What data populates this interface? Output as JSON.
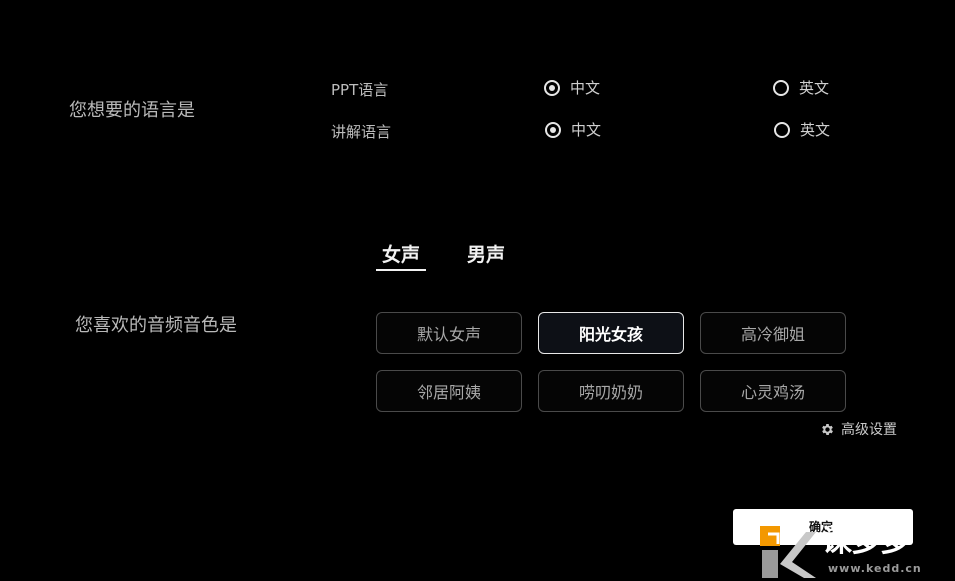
{
  "language": {
    "title": "您想要的语言是",
    "ppt": {
      "label": "PPT语言",
      "options": [
        "中文",
        "英文"
      ],
      "selected": 0
    },
    "narration": {
      "label": "讲解语言",
      "options": [
        "中文",
        "英文"
      ],
      "selected": 0
    }
  },
  "voice": {
    "title": "您喜欢的音频音色是",
    "tabs": [
      "女声",
      "男声"
    ],
    "active_tab": 0,
    "options": [
      "默认女声",
      "阳光女孩",
      "高冷御姐",
      "邻居阿姨",
      "唠叨奶奶",
      "心灵鸡汤"
    ],
    "selected": 1,
    "advanced_label": "高级设置"
  },
  "confirm_label": "确定",
  "watermark": {
    "brand": "课多多",
    "url": "www.kedd.cn"
  },
  "colors": {
    "background": "#000000",
    "accent": "#f39800"
  }
}
